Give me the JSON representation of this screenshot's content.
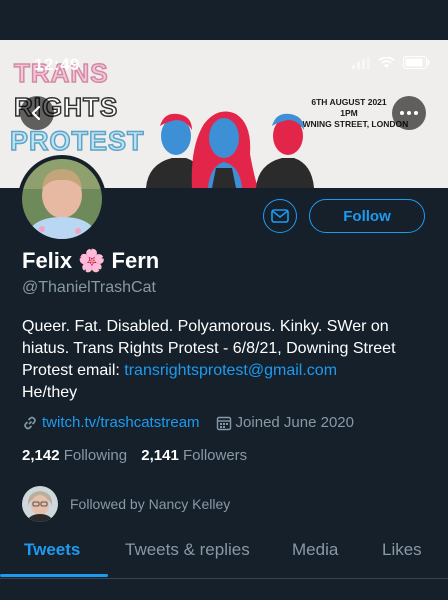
{
  "status_bar": {
    "time": "12:49"
  },
  "banner": {
    "line1": "TRANS",
    "line2": "RIGHTS",
    "line3": "PROTEST",
    "event_date": "6TH AUGUST 2021",
    "event_time": "1PM",
    "event_location": "DOWNING STREET, LONDON"
  },
  "profile": {
    "name_first": "Felix",
    "name_emoji": "🌸",
    "name_last": "Fern",
    "handle": "@ThanielTrashCat",
    "bio_text": "Queer. Fat. Disabled. Polyamorous. Kinky. SWer on hiatus. Trans Rights Protest - 6/8/21, Downing Street Protest email: ",
    "bio_email": "transrightsprotest@gmail.com",
    "bio_pronouns": "He/they",
    "website": "twitch.tv/trashcatstream",
    "joined": "Joined June 2020",
    "following_count": "2,142",
    "following_label": "Following",
    "followers_count": "2,141",
    "followers_label": "Followers",
    "followed_by": "Followed by Nancy Kelley"
  },
  "actions": {
    "follow_label": "Follow"
  },
  "tabs": [
    {
      "label": "Tweets"
    },
    {
      "label": "Tweets & replies"
    },
    {
      "label": "Media"
    },
    {
      "label": "Likes"
    }
  ],
  "colors": {
    "background": "#15202b",
    "accent": "#1d9bf0",
    "secondary_text": "#8899a6"
  }
}
